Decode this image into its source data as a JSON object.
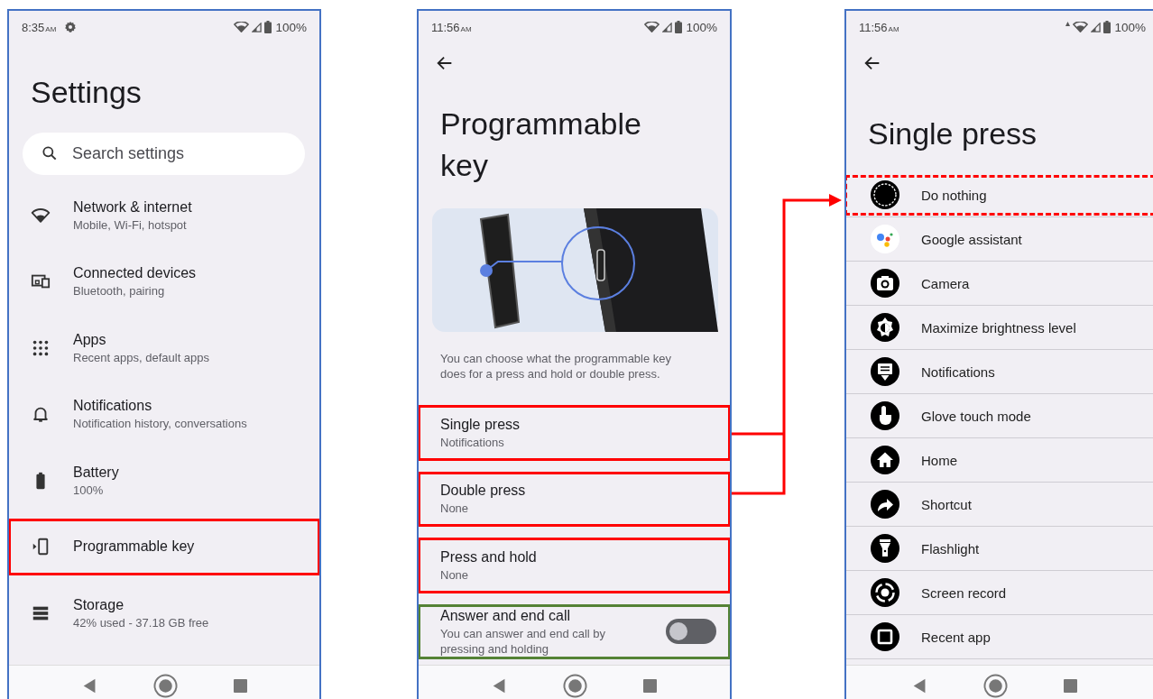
{
  "settings_screen": {
    "status": {
      "time": "8:35",
      "ampm": "AM",
      "battery": "100%"
    },
    "title": "Settings",
    "search": {
      "placeholder": "Search settings"
    },
    "items": [
      {
        "title": "Network & internet",
        "subtitle": "Mobile, Wi-Fi, hotspot"
      },
      {
        "title": "Connected devices",
        "subtitle": "Bluetooth, pairing"
      },
      {
        "title": "Apps",
        "subtitle": "Recent apps, default apps"
      },
      {
        "title": "Notifications",
        "subtitle": "Notification history, conversations"
      },
      {
        "title": "Battery",
        "subtitle": "100%"
      },
      {
        "title": "Programmable key",
        "color": "#ff0000"
      },
      {
        "title": "Storage",
        "subtitle": "42% used - 37.18 GB free"
      }
    ]
  },
  "programmable_key_screen": {
    "status": {
      "time": "11:56",
      "ampm": "AM",
      "battery": "100%"
    },
    "title": "Programmable key",
    "description": "You can choose what the programmable key does for a press and hold or double press.",
    "items": [
      {
        "kind": "option",
        "title": "Single press",
        "subtitle": "Notifications",
        "color": "#ff0000"
      },
      {
        "kind": "option",
        "title": "Double press",
        "subtitle": "None",
        "color": "#ff0000"
      },
      {
        "kind": "option",
        "title": "Press and hold",
        "subtitle": "None",
        "color": "#ff0000"
      },
      {
        "kind": "switch",
        "title": "Answer and end call",
        "subtitle": "You can answer and end call by pressing and holding",
        "on": false,
        "color": "#548235"
      }
    ]
  },
  "single_press_screen": {
    "status": {
      "time": "11:56",
      "ampm": "AM",
      "battery": "100%"
    },
    "title": "Single press",
    "options": [
      {
        "label": "Do nothing",
        "color": "#ff0000"
      },
      {
        "label": "Google assistant"
      },
      {
        "label": "Camera"
      },
      {
        "label": "Maximize brightness level"
      },
      {
        "label": "Notifications"
      },
      {
        "label": "Glove touch mode"
      },
      {
        "label": "Home"
      },
      {
        "label": "Shortcut"
      },
      {
        "label": "Flashlight"
      },
      {
        "label": "Screen record"
      },
      {
        "label": "Recent app"
      }
    ]
  }
}
